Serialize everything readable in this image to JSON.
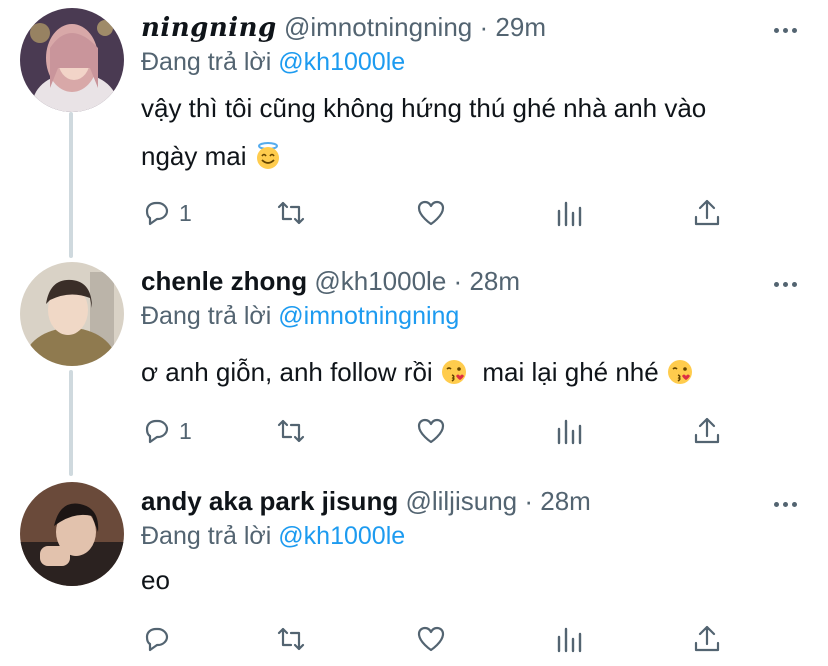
{
  "tweets": [
    {
      "display_name": "ningning",
      "handle": "@imnotningning",
      "separator": "·",
      "time": "29m",
      "replying_prefix": "Đang trả lời",
      "replying_to": "@kh1000le",
      "text_line1": "vậy thì tôi cũng không hứng thú ghé nhà anh vào",
      "text_line2": "ngày mai",
      "reply_count": "1"
    },
    {
      "display_name": "chenle zhong",
      "handle": "@kh1000le",
      "separator": "·",
      "time": "28m",
      "replying_prefix": "Đang trả lời",
      "replying_to": "@imnotningning",
      "text_part1": "ơ anh giỗn, anh follow rồi",
      "text_part2": "mai lại ghé nhé",
      "reply_count": "1"
    },
    {
      "display_name": "andy aka park jisung",
      "handle": "@liljisung",
      "separator": "·",
      "time": "28m",
      "replying_prefix": "Đang trả lời",
      "replying_to": "@kh1000le",
      "text": "eo",
      "reply_count": ""
    }
  ],
  "colors": {
    "accent": "#1d9bf0",
    "secondary_text": "#536471",
    "thread_line": "#cfd9de"
  },
  "icons": [
    "reply-icon",
    "retweet-icon",
    "like-icon",
    "analytics-icon",
    "share-icon",
    "more-icon",
    "smiling-halo-emoji",
    "kissing-wink-emoji"
  ]
}
